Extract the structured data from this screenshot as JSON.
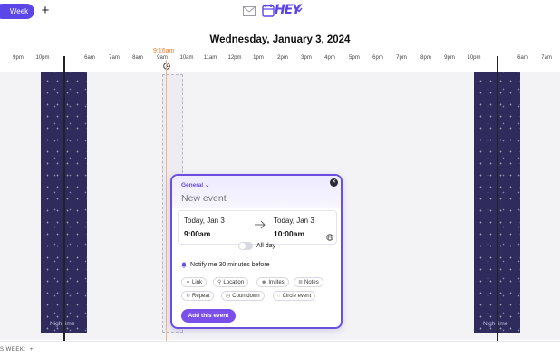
{
  "header": {
    "view_button": "Week",
    "add_icon": "plus-icon",
    "mail_icon": "envelope-icon",
    "calendar_icon": "calendar-icon",
    "logo": "HEY",
    "accent": "#5b46e8"
  },
  "date_title": "Wednesday, January 3, 2024",
  "now_indicator": {
    "time": "9:16am",
    "color": "#f07a2c"
  },
  "hours": [
    "9pm",
    "10pm",
    "6am",
    "7am",
    "8am",
    "9am",
    "10am",
    "11am",
    "12pm",
    "1pm",
    "2pm",
    "3pm",
    "4pm",
    "5pm",
    "6pm",
    "7pm",
    "8pm",
    "9pm",
    "10pm",
    "6am",
    "7am"
  ],
  "night": {
    "label_left": "Nigh time",
    "label_right": "Nigh time",
    "color": "#2f2c5d"
  },
  "bottom_bar": {
    "label": "S WEEK",
    "add": "+"
  },
  "popup": {
    "calendar_name": "General",
    "title_placeholder": "New event",
    "start_date": "Today, Jan 3",
    "start_time": "9:00am",
    "end_date": "Today, Jan 3",
    "end_time": "10:00am",
    "all_day_label": "All day",
    "all_day": false,
    "notify": "Notify me 30 minutes before",
    "chips": [
      "Link",
      "Location",
      "Invites",
      "Notes",
      "Repeat",
      "Countdown",
      "Circle event"
    ],
    "add_button": "Add this event",
    "accent": "#6a4ee0"
  }
}
